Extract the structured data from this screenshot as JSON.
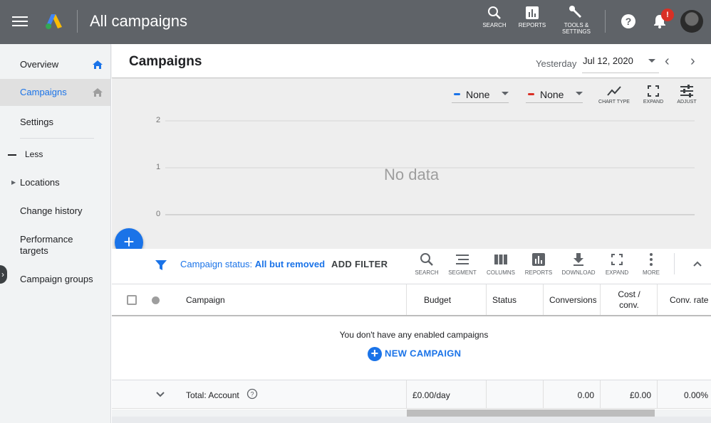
{
  "header": {
    "title": "All campaigns",
    "tools": [
      {
        "label": "SEARCH",
        "icon": "search-icon"
      },
      {
        "label": "REPORTS",
        "icon": "reports-icon"
      },
      {
        "label": "TOOLS &",
        "label2": "SETTINGS",
        "icon": "wrench-icon"
      }
    ],
    "notification_badge": "!"
  },
  "sidebar": {
    "items": [
      {
        "label": "Overview"
      },
      {
        "label": "Campaigns"
      },
      {
        "label": "Settings"
      },
      {
        "label": "Less"
      },
      {
        "label": "Locations"
      },
      {
        "label": "Change history"
      },
      {
        "label": "Performance",
        "label2": "targets"
      },
      {
        "label": "Campaign groups"
      }
    ]
  },
  "page": {
    "title": "Campaigns",
    "date_label": "Yesterday",
    "date_value": "Jul 12, 2020"
  },
  "chart": {
    "metric1": "None",
    "metric1_color": "#1a73e8",
    "metric2": "None",
    "metric2_color": "#d93025",
    "tools": [
      "CHART TYPE",
      "EXPAND",
      "ADJUST"
    ],
    "empty_text": "No data"
  },
  "chart_data": {
    "type": "line",
    "series": [],
    "yticks": [
      "2",
      "1",
      "0"
    ],
    "ylim": [
      0,
      2
    ],
    "grid": true
  },
  "filter_bar": {
    "status_prefix": "Campaign status:",
    "status_value": "All but removed",
    "add_filter": "ADD FILTER",
    "tools": [
      "SEARCH",
      "SEGMENT",
      "COLUMNS",
      "REPORTS",
      "DOWNLOAD",
      "EXPAND",
      "MORE"
    ]
  },
  "table": {
    "columns": [
      "Campaign",
      "Budget",
      "Status",
      "Conversions",
      "Cost /",
      "conv.",
      "Conv. rate"
    ],
    "empty_message": "You don't have any enabled campaigns",
    "new_campaign": "NEW CAMPAIGN",
    "total": {
      "label": "Total: Account",
      "budget": "£0.00/day",
      "conversions": "0.00",
      "cost_conv": "£0.00",
      "conv_rate": "0.00%"
    }
  }
}
